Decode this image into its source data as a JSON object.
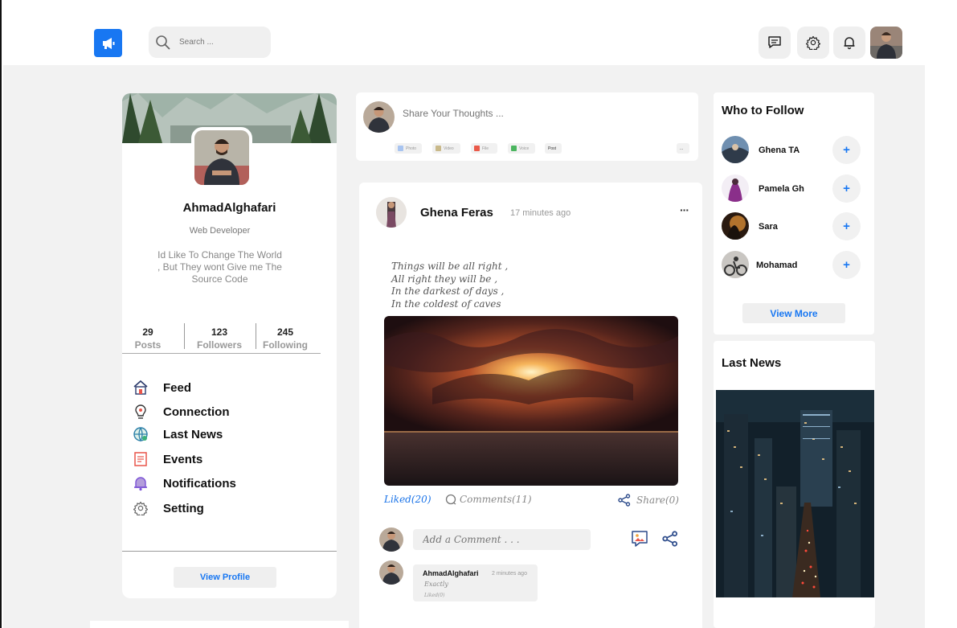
{
  "search": {
    "placeholder": "Search ..."
  },
  "profile": {
    "name": "AhmadAlghafari",
    "role": "Web Developer",
    "bio_lines": [
      "Id Like To Change The World",
      ", But They wont Give me The",
      "Source Code"
    ],
    "stats": [
      {
        "value": "29",
        "label": "Posts"
      },
      {
        "value": "123",
        "label": "Followers"
      },
      {
        "value": "245",
        "label": "Following"
      }
    ],
    "view_profile_label": "View Profile"
  },
  "menu": [
    {
      "label": "Feed",
      "icon": "home-icon"
    },
    {
      "label": "Connection",
      "icon": "connection-icon"
    },
    {
      "label": "Last News",
      "icon": "globe-icon"
    },
    {
      "label": "Events",
      "icon": "events-icon"
    },
    {
      "label": "Notifications",
      "icon": "bell-icon"
    },
    {
      "label": "Setting",
      "icon": "gear-icon"
    }
  ],
  "composer": {
    "placeholder": "Share Your Thoughts ...",
    "chips": [
      "Photo",
      "Video",
      "File",
      "Voice",
      "Post",
      "..."
    ]
  },
  "post": {
    "author": "Ghena Feras",
    "time": "17 minutes ago",
    "more": "···",
    "poem": [
      "Things will be all right ,",
      "All right they will be ,",
      "In the darkest of days ,",
      "In the coldest of caves"
    ],
    "liked": "Liked(20)",
    "comments": "Comments(11)",
    "share": "Share(0)",
    "comment_placeholder": "Add a Comment . . .",
    "reply": {
      "author": "AhmadAlghafari",
      "time": "2 minutes ago",
      "text": "Exactly",
      "liked": "Liked(0)"
    }
  },
  "follow": {
    "title": "Who to Follow",
    "people": [
      "Ghena TA",
      "Pamela Gh",
      "Sara",
      "Mohamad"
    ],
    "add_label": "+",
    "view_more_label": "View More"
  },
  "news": {
    "title": "Last News"
  },
  "colors": {
    "accent": "#1877f2",
    "background": "#f2f2f2"
  }
}
